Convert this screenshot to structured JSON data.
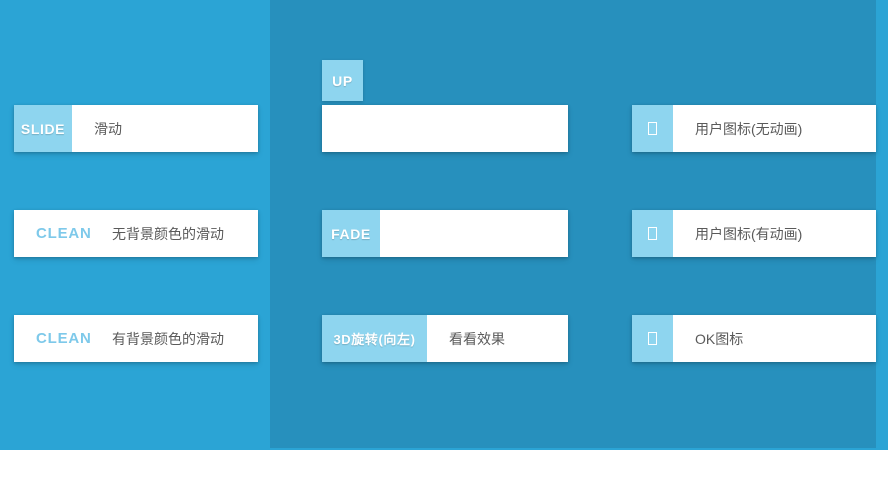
{
  "theme": {
    "page_background": "#ffffff",
    "column_light": "#2ba4d5",
    "column_dark": "#2790bd",
    "label_block": "#8ed5ef",
    "label_text": "#ffffff",
    "plain_label_text": "#7ec9ea",
    "body_text": "#5a5a5a",
    "card_background": "#ffffff"
  },
  "columns": {
    "left": {
      "name": "left-column",
      "cards": [
        {
          "id": "slide",
          "label": "SLIDE",
          "text": "滑动",
          "label_style": "block"
        },
        {
          "id": "clean-1",
          "label": "CLEAN",
          "text": "无背景颜色的滑动",
          "label_style": "plain"
        },
        {
          "id": "clean-2",
          "label": "CLEAN",
          "text": "有背景颜色的滑动",
          "label_style": "plain"
        }
      ]
    },
    "middle": {
      "name": "middle-column",
      "floating_label": "UP",
      "cards": [
        {
          "id": "up",
          "label": "",
          "text": "",
          "label_style": "detached"
        },
        {
          "id": "fade",
          "label": "FADE",
          "text": "",
          "label_style": "block"
        },
        {
          "id": "rotate",
          "label": "3D旋转(向左)",
          "text": "看看效果",
          "label_style": "block"
        }
      ]
    },
    "right": {
      "name": "right-column",
      "cards": [
        {
          "id": "user-static",
          "icon": "missing-glyph-box-icon",
          "text": "用户图标(无动画)",
          "label_style": "icon"
        },
        {
          "id": "user-anim",
          "icon": "missing-glyph-box-icon",
          "text": "用户图标(有动画)",
          "label_style": "icon"
        },
        {
          "id": "ok",
          "icon": "missing-glyph-box-icon",
          "text": "OK图标",
          "label_style": "icon"
        }
      ]
    }
  }
}
